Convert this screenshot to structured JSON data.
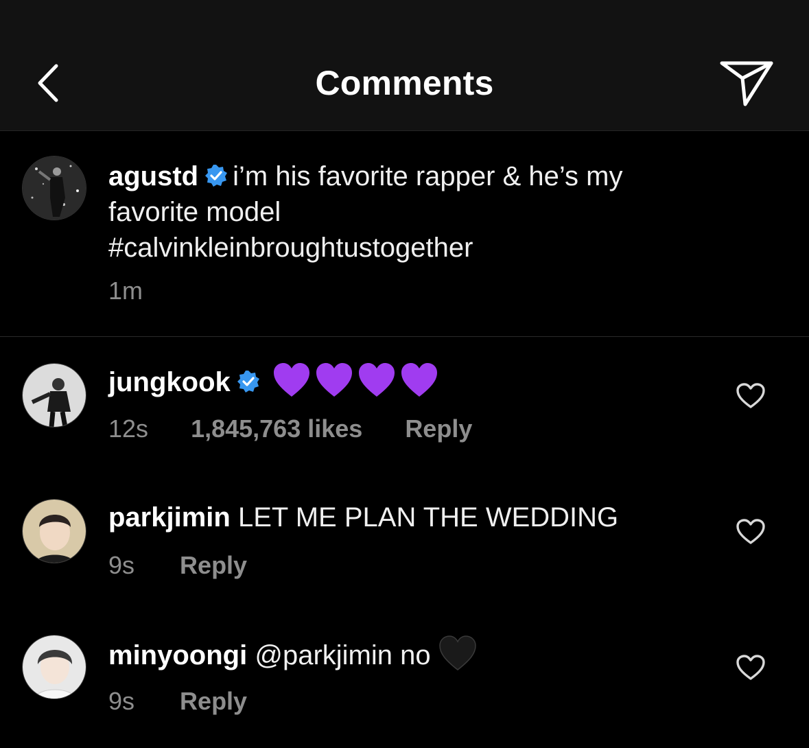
{
  "header": {
    "title": "Comments"
  },
  "caption": {
    "username": "agustd",
    "text_line1": "i’m his favorite rapper & he’s my",
    "text_line2": "favorite model",
    "hashtag": "#calvinkleinbroughtustogether",
    "time": "1m"
  },
  "comments": [
    {
      "username": "jungkook",
      "text": "",
      "emoji": "purple-heart x4",
      "time": "12s",
      "likes": "1,845,763 likes",
      "reply": "Reply"
    },
    {
      "username": "parkjimin",
      "text": "LET ME PLAN THE WEDDING",
      "time": "9s",
      "reply": "Reply"
    },
    {
      "username": "minyoongi",
      "text": "@parkjimin no",
      "emoji": "black-heart",
      "time": "9s",
      "reply": "Reply"
    }
  ],
  "colors": {
    "background": "#000000",
    "header": "#121212",
    "verified": "#3897f0",
    "muted": "#8e8e8e",
    "purple_heart": "#a03cf0"
  }
}
